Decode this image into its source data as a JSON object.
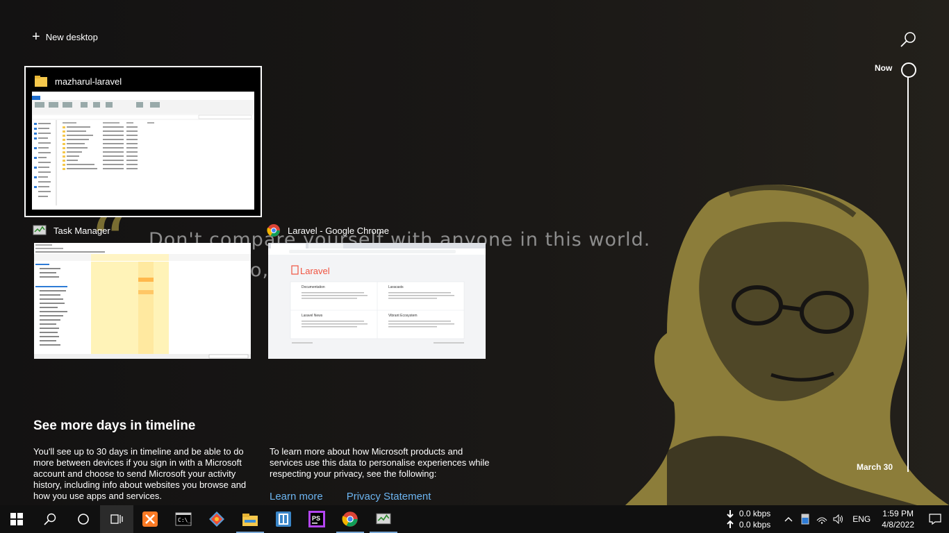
{
  "new_desktop_label": "New desktop",
  "quote": {
    "line1": "Don't compare yourself with anyone in this world.",
    "line2": "o,                                          yourself."
  },
  "windows": [
    {
      "title": "mazharul-laravel",
      "icon": "folder-icon",
      "selected": true
    },
    {
      "title": "Task Manager",
      "icon": "task-manager-icon",
      "selected": false
    },
    {
      "title": "Laravel - Google Chrome",
      "icon": "chrome-icon",
      "selected": false
    }
  ],
  "chrome_preview": {
    "brand": "Laravel",
    "cards": [
      "Documentation",
      "Laracasts",
      "Laravel News",
      "Vibrant Ecosystem"
    ]
  },
  "timeline": {
    "now_label": "Now",
    "end_label": "March 30"
  },
  "more_days": {
    "title": "See more days in timeline",
    "left_text": "You'll see up to 30 days in timeline and be able to do more between devices if you sign in with a Microsoft account and choose to send Microsoft your activity history, including info about websites you browse and how you use apps and services.",
    "right_text": "To learn more about how Microsoft products and services use this data to personalise experiences while respecting your privacy, see the following:",
    "link_learn_more": "Learn more",
    "link_privacy": "Privacy Statement"
  },
  "taskbar": {
    "apps": [
      "start-icon",
      "search-icon",
      "cortana-icon",
      "task-view-icon",
      "xampp-icon",
      "terminal-icon",
      "git-icon",
      "file-explorer-icon",
      "app-icon",
      "phpstorm-icon",
      "chrome-icon",
      "task-manager-icon"
    ],
    "network_down": "0.0 kbps",
    "network_up": "0.0 kbps",
    "language": "ENG",
    "time": "1:59 PM",
    "date": "4/8/2022"
  },
  "colors": {
    "accent": "#7aa8d6",
    "link": "#6cb4f0",
    "quote_gold": "#8b7d38"
  }
}
